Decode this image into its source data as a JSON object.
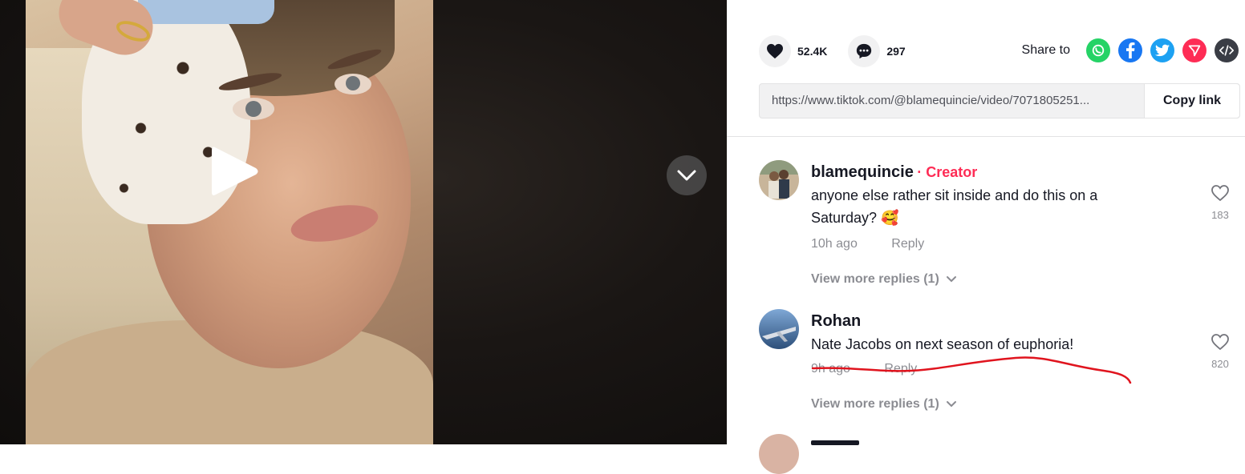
{
  "stats": {
    "likes": "52.4K",
    "comments": "297"
  },
  "share": {
    "label": "Share to",
    "icons": [
      "whatsapp-icon",
      "facebook-icon",
      "twitter-icon",
      "send-icon",
      "embed-icon"
    ],
    "colors": {
      "whatsapp": "#25d366",
      "facebook": "#1877f2",
      "twitter": "#1da1f2",
      "send": "#fe2c55",
      "embed": "#3a3d45"
    }
  },
  "link": {
    "url": "https://www.tiktok.com/@blamequincie/video/7071805251...",
    "copy_label": "Copy link"
  },
  "comments": [
    {
      "user": "blamequincie",
      "badge": "· Creator",
      "text_line1": "anyone else rather sit inside and do this on a",
      "text_line2": "Saturday? 🥰",
      "time": "10h ago",
      "reply": "Reply",
      "more": "View more replies (1)",
      "likes": "183"
    },
    {
      "user": "Rohan",
      "text_line1": "Nate Jacobs on next season of euphoria!",
      "time": "9h ago",
      "reply": "Reply",
      "more": "View more replies (1)",
      "likes": "820"
    }
  ],
  "colors": {
    "accent": "#fe2c55",
    "annotation": "#e0141e"
  }
}
